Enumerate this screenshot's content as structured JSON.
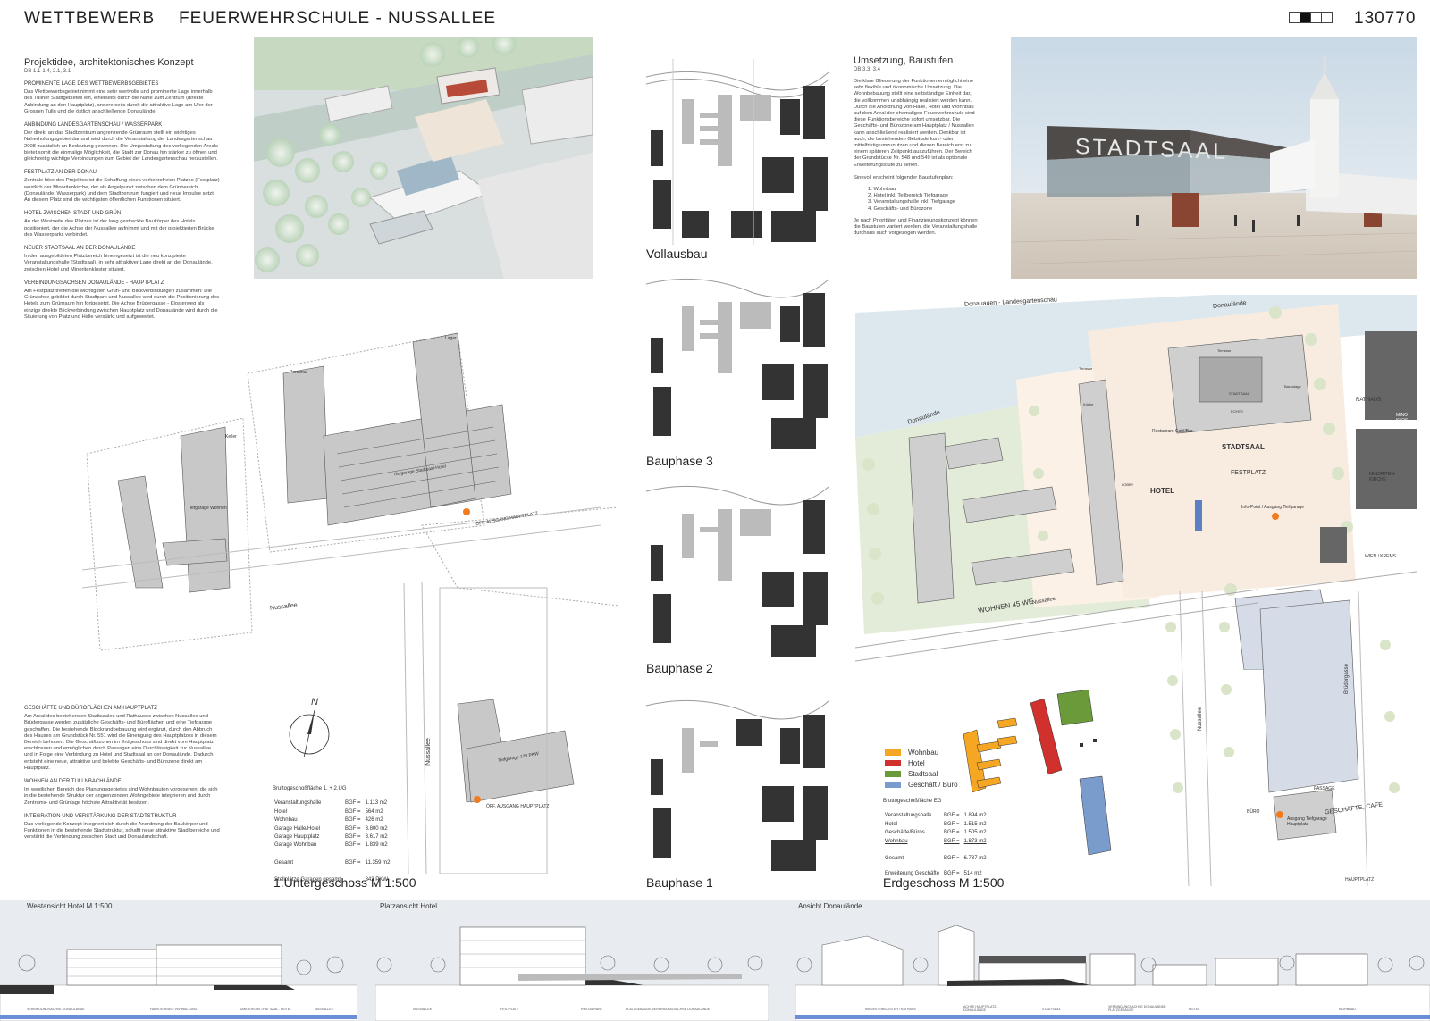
{
  "header": {
    "left": "WETTBEWERB",
    "title": "FEUERWEHRSCHULE - NUSSALLEE",
    "number": "130770"
  },
  "concept": {
    "title": "Projektidee, architektonisches Konzept",
    "ref": "DB 1.1-1.4, 2.1, 3.1",
    "sections": [
      {
        "heading": "PROMINENTE LAGE DES WETTBEWERBSGEBIETES",
        "text": "Das Wettbewerbsgebiet nimmt eine sehr wertvolle und prominente Lage innerhalb des Tullner Stadtgebietes ein, einerseits durch die Nähe zum Zentrum (direkte Anbindung an den Hauptplatz), andererseits durch die attraktive Lage am Ufer der Grossen Tulln und die östlich anschließende Donaulände."
      },
      {
        "heading": "ANBINDUNG LANDESGARTENSCHAU / WASSERPARK",
        "text": "Der direkt an das Stadtzentrum angrenzende Grünraum stellt ein wichtiges Naherholungsgebiet dar und wird durch die Veranstaltung der Landesgartenschau 2008 zusätzlich an Bedeutung gewinnen. Die Umgestaltung des vorliegenden Areals bietet somit die einmalige Möglichkeit, die Stadt zur Donau hin stärker zu öffnen und gleichzeitig wichtige Verbindungen zum Gebiet der Landesgartenschau herzustellen."
      },
      {
        "heading": "FESTPLATZ AN DER DONAU",
        "text": "Zentrale Idee des Projektes ist die Schaffung eines verkehrsfreien Platzes (Festplatz) westlich der Minoritenkirche, der als Angelpunkt zwischen dem Grünbereich (Donaulände, Wasserpark) und dem Stadtzentrum fungiert und neue Impulse setzt. An diesem Platz sind die wichtigsten öffentlichen Funktionen situiert."
      },
      {
        "heading": "HOTEL ZWISCHEN STADT UND GRÜN",
        "text": "An der Westseite des Platzes ist der lang gestreckte Baukörper des Hotels positioniert, der die Achse der Nussallee aufnimmt und mit der projektierten Brücke des Wasserparks verbindet."
      },
      {
        "heading": "NEUER STADTSAAL AN DER DONAULÄNDE",
        "text": "In den ausgebildeten Platzbereich hineingesetzt ist die neu konzipierte Veranstaltungshalle (Stadtsaal), in sehr attraktiver Lage direkt an der Donaulände, zwischen Hotel und Minoritenkloster situiert."
      },
      {
        "heading": "VERBINDUNGSACHSEN DONAULÄNDE - HAUPTPLATZ",
        "text": "Am Festplatz treffen die wichtigsten Grün- und Blickverbindungen zusammen: Die Grünachse gebildet durch Stadtpark und Nussallee wird durch die Positionierung des Hotels zum Grünraum hin fortgesetzt. Die Achse Brüdergasse - Klosterweg als einzige direkte Blickverbindung zwischen Hauptplatz und Donaulände wird durch die Situierung von Platz und Halle verstärkt und aufgewertet."
      }
    ],
    "sections2": [
      {
        "heading": "GESCHÄFTE UND BÜROFLÄCHEN AM HAUPTPLATZ",
        "text": "Am Areal des bestehenden Stadtsaales und Rathauses zwischen Nussallee und Brüdergasse werden zusätzliche Geschäfts- und Büroflächen und eine Tiefgarage geschaffen. Die bestehende Blockrandbebauung wird ergänzt, durch den Abbruch des Hauses am Grundstück Nr. 551 wird die Einengung des Hauptplatzes in diesem Bereich behoben. Die Geschäftszonen im Erdgeschoss sind direkt vom Hauptplatz erschlossen und ermöglichen durch Passagen eine Durchlässigkeit zur Nussallee und in Folge eine Verbindung zu Hotel und Stadtsaal an der Donaulände. Dadurch entsteht eine neue, attraktive und belebte Geschäfts- und Bürozone direkt am Hauptplatz."
      },
      {
        "heading": "WOHNEN AN DER TULLNBACHLÄNDE",
        "text": "Im westlichen Bereich des Planungsgebietes sind Wohnbauten vorgesehen, die sich in die bestehende Struktur der angrenzenden Wohngebiete integrieren und durch Zentrums- und Grünlage höchste Attraktivität besitzen."
      },
      {
        "heading": "INTEGRATION UND VERSTÄRKUNG DER STADTSTRUKTUR",
        "text": "Das vorliegende Konzept integriert sich durch die Anordnung der Baukörper und Funktionen in die bestehende Stadtstruktur, schafft neue attraktive Stadtbereiche und verstärkt die Verbindung zwischen Stadt und Donaulandschaft."
      }
    ]
  },
  "umsetzung": {
    "title": "Umsetzung, Baustufen",
    "ref": "DB 3.3, 3.4",
    "text1": "Die klare Gliederung der Funktionen ermöglicht eine sehr flexible und ökonomische Umsetzung. Die Wohnbebauung stellt eine selbständige Einheit dar, die vollkommen unabhängig realisiert werden kann. Durch die Anordnung von Halle, Hotel und Wohnbau auf dem Areal der ehemaligen Feuerwehrschule sind diese Funktionsbereiche sofort umsetzbar. Die Geschäfts- und Bürozone am Hauptplatz / Nussallee kann anschließend realisiert werden. Denkbar ist auch, die bestehenden Gebäude kurz- oder mittelfristig umzunutzen und diesen Bereich erst zu einem späteren Zeitpunkt auszuführen. Der Bereich der Grundstücke Nr. 548 und 549 ist als optionale Erweiterungsstufe zu sehen.",
    "text2": "Sinnvoll erscheint folgender Baustufenplan:",
    "steps": [
      "1.  Wohnbau",
      "2.  Hotel inkl. Teilbereich Tiefgarage",
      "3.  Veranstaltungshalle inkl. Tiefgarage",
      "4.  Geschäfts- und Bürozone"
    ],
    "text3": "Je nach Prioritäten und Finanzierungskonzept können die Baustufen variiert werden, die Veranstaltungshalle durchaus auch vorgezogen werden."
  },
  "phases": [
    "Vollausbau",
    "Bauphase 3",
    "Bauphase 2",
    "Bauphase 1"
  ],
  "basement": {
    "caption": "1.Untergeschoss  M 1:500",
    "stats_title": "Bruttogeschoßfläche 1. + 2.UG",
    "rows": [
      [
        "Veranstaltungshalle",
        "BGF =",
        "1.113 m2"
      ],
      [
        "Hotel",
        "BGF =",
        "564 m2"
      ],
      [
        "Wohnbau",
        "BGF =",
        "426 m2"
      ],
      [
        "Garage Halle/Hotel",
        "BGF =",
        "3.800 m2"
      ],
      [
        "Garage Hauptplatz",
        "BGF =",
        "3.617 m2"
      ],
      [
        "Garage Wohnbau",
        "BGF =",
        "1.839 m2"
      ]
    ],
    "total": [
      "Gesamt",
      "BGF =",
      "11.359 m2"
    ],
    "parking": [
      "Stellplätze Garagen gesamt",
      "342 PKW"
    ],
    "labels": {
      "nussallee": "Nussallee",
      "nussallee2": "Nussallee",
      "north": "N",
      "tg_wohnbau": "Tiefgarage Wohnen",
      "tg_hotel": "Tiefgarage Stadtsaal-Hotel",
      "tg_haupt": "Tiefgarage 120 PKW",
      "aufgang1": "ÖFF. AUSGANG HAUPTPLATZ",
      "aufgang2": "ÖFF. AUSGANG HAUPTPLATZ",
      "lager": "Lager",
      "personal": "Personal",
      "kinder": "Keller"
    }
  },
  "ground": {
    "caption": "Erdgeschoss  M 1:500",
    "legend": [
      {
        "label": "Wohnbau",
        "color": "#f5a623"
      },
      {
        "label": "Hotel",
        "color": "#d0312d"
      },
      {
        "label": "Stadtsaal",
        "color": "#6a9a3a"
      },
      {
        "label": "Geschaft / Büro",
        "color": "#7a9ccc"
      }
    ],
    "stats_title": "Bruttogeschoßfläche EG",
    "rows": [
      [
        "Veranstaltungshalle",
        "BGF =",
        "1.894 m2"
      ],
      [
        "Hotel",
        "BGF =",
        "1.515 m2"
      ],
      [
        "Geschäfte/Büros",
        "BGF =",
        "1.505 m2"
      ],
      [
        "Wohnbau",
        "BGF =",
        "1.873 m2"
      ]
    ],
    "total": [
      "Gesamt",
      "BGF =",
      "6.787 m2"
    ],
    "ext": [
      "Erweiterung Geschäfte",
      "BGF =",
      "514 m2"
    ],
    "labels": {
      "donauauen": "Donauauen - Landesgartenschau",
      "donaulaende1": "Donaulände",
      "donaulaende2": "Donaulände",
      "stadtsaal": "STADTSAAL",
      "festplatz": "FESTPLATZ",
      "hotel": "HOTEL",
      "rathaus": "RATHAUS",
      "minoriten": "MINORITEN-KIRCHE",
      "wohnen": "WOHNEN 45 WE",
      "nussallee": "Nussallee",
      "nussallee2": "Nussallee",
      "infopoint": "Info-Point / Ausgang Tiefgarage",
      "wien": "WIEN / KREMS",
      "passage": "PASSAGE",
      "geschaefte": "GESCHÄFTE, CAFE",
      "buero": "BÜRO",
      "ausgang": "Ausgang Tiefgarage Hauptplatz",
      "hauptplatz": "HAUPTPLATZ",
      "restaurant": "Restaurant Café/Bar",
      "lobby": "LOBBY",
      "brueder": "Brüdergasse",
      "minoklos": "MINO KLOS",
      "foyer": "FOYER",
      "saal": "STADTSAAL",
      "terrasse": "Terrasse",
      "terrasse2": "Terrasse",
      "backstage": "Backstage",
      "kueche": "Küche"
    }
  },
  "render": {
    "sign": "STADTSAAL"
  },
  "elevations": [
    {
      "title": "Westansicht Hotel  M 1:500",
      "labels": [
        "VERBINDUNGSACHSE DONAULÄNDE",
        "HAUSTERRAS / VERWALTUNG",
        "SARGERSTATTHAT SAAL - HOTEL",
        "NUSSALLEE"
      ]
    },
    {
      "title": "Platzansicht Hotel",
      "labels": [
        "NUSSALLEE",
        "FESTPLATZ",
        "RESTAURANT",
        "PLATZGEBÄUDE VERBINDUNGSACHSE DONAULÄNDE"
      ]
    },
    {
      "title": "Ansicht Donaulände",
      "labels": [
        "MINORITENKLOSTER / RATHAUS",
        "ACHSE HAUPTPLATZ - DONAULÄNDE",
        "STADTSAAL",
        "VERBINDUNGSACHSE DONAULÄNDE PLATZGEBÄUDE",
        "HOTEL",
        "WOHNBAU"
      ]
    }
  ]
}
